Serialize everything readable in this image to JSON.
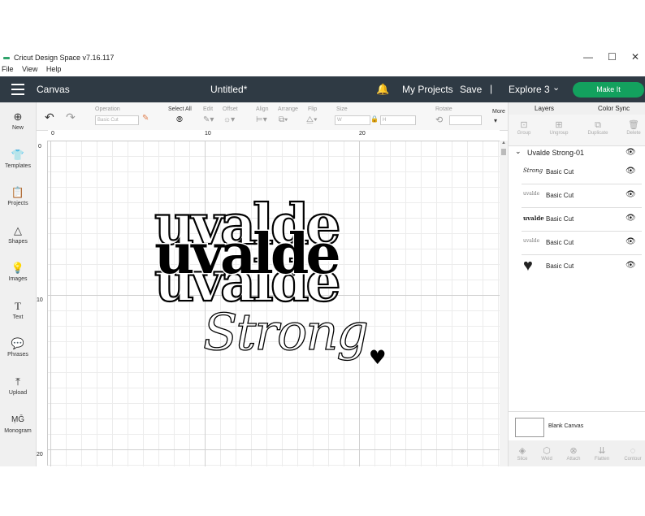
{
  "window": {
    "app_title": "Cricut Design Space  v7.16.117",
    "minimize": "—",
    "maximize": "☐",
    "close": "✕"
  },
  "menu": [
    "File",
    "View",
    "Help"
  ],
  "topbar": {
    "section": "Canvas",
    "project_name": "Untitled*",
    "my_projects": "My Projects",
    "save": "Save",
    "separator": "|",
    "machine": "Explore 3",
    "make_it": "Make It",
    "chevron": "⌄",
    "bell": "🔔"
  },
  "nav": [
    {
      "label": "New",
      "icon": "⊕"
    },
    {
      "label": "Templates",
      "icon": "👕"
    },
    {
      "label": "Projects",
      "icon": "📋"
    },
    {
      "label": "Shapes",
      "icon": "△"
    },
    {
      "label": "Images",
      "icon": "💡"
    },
    {
      "label": "Text",
      "icon": "T"
    },
    {
      "label": "Phrases",
      "icon": "💬"
    },
    {
      "label": "Upload",
      "icon": "⤒"
    },
    {
      "label": "Monogram",
      "icon": "ṂḠ"
    }
  ],
  "edit": {
    "undo": "↶",
    "redo": "↷",
    "operation_label": "Operation",
    "operation_value": "Basic Cut",
    "select_all": "Select All",
    "edit": "Edit",
    "offset": "Offset",
    "align": "Align",
    "arrange": "Arrange",
    "flip": "Flip",
    "size": "Size",
    "w": "W",
    "h": "H",
    "rotate": "Rotate",
    "more": "More"
  },
  "ruler": {
    "top": [
      "0",
      "10",
      "20"
    ],
    "left": [
      "0",
      "10",
      "20"
    ]
  },
  "panel": {
    "tabs": [
      "Layers",
      "Color Sync"
    ],
    "tools": [
      "Group",
      "Ungroup",
      "Duplicate",
      "Delete"
    ],
    "tool_icons": [
      "⊡",
      "⊞",
      "⧉",
      "🗑"
    ],
    "group_name": "Uvalde Strong-01",
    "layers": [
      {
        "label": "Basic Cut",
        "thumb": "Strong"
      },
      {
        "label": "Basic Cut",
        "thumb": "uvalde"
      },
      {
        "label": "Basic Cut",
        "thumb": "uvalde"
      },
      {
        "label": "Basic Cut",
        "thumb": "uvalde"
      },
      {
        "label": "Basic Cut",
        "thumb": "♥"
      }
    ],
    "eye": "👁",
    "blank_canvas": "Blank Canvas",
    "bottom_tools": [
      "Slice",
      "Weld",
      "Attach",
      "Flatten",
      "Contour"
    ],
    "bottom_icons": [
      "◈",
      "⬡",
      "⊗",
      "⇊",
      "◌"
    ]
  },
  "design": {
    "word": "uvalde",
    "script": "Strong",
    "heart": "♥"
  }
}
